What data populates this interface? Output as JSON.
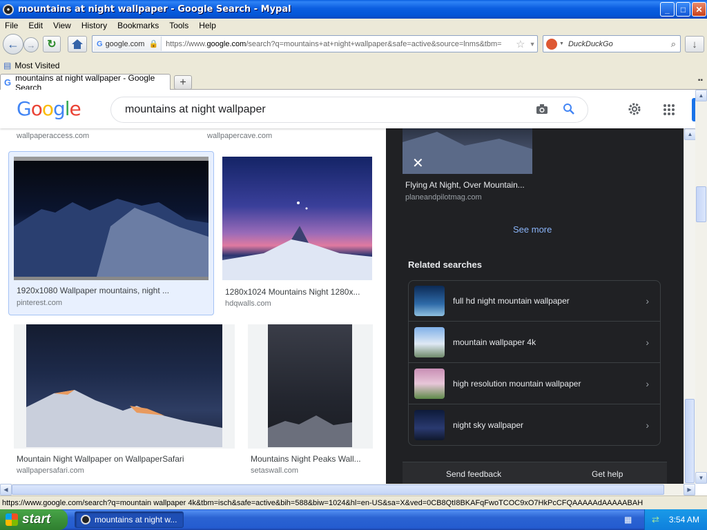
{
  "window": {
    "title": "mountains at night wallpaper - Google Search - Mypal",
    "minimize": "_",
    "maximize": "□",
    "close": "✕"
  },
  "menu": [
    "File",
    "Edit",
    "View",
    "History",
    "Bookmarks",
    "Tools",
    "Help"
  ],
  "nav": {
    "identity": "google.com",
    "url_prefix": "https://www.",
    "url_domain": "google.com",
    "url_rest": "/search?q=mountains+at+night+wallpaper&safe=active&source=lnms&tbm=",
    "search_placeholder": "DuckDuckGo"
  },
  "bookmarks": {
    "most_visited": "Most Visited"
  },
  "tab": {
    "label": "mountains at night wallpaper - Google Search"
  },
  "google": {
    "logo_letters": [
      "G",
      "o",
      "o",
      "g",
      "l",
      "e"
    ],
    "query": "mountains at night wallpaper"
  },
  "results": {
    "top_sources": [
      "wallpaperaccess.com",
      "wallpapercave.com"
    ],
    "items": [
      {
        "caption": "1920x1080 Wallpaper mountains, night ...",
        "source": "pinterest.com"
      },
      {
        "caption": "1280x1024 Mountains Night 1280x...",
        "source": "hdqwalls.com"
      },
      {
        "caption": "Mountain Night Wallpaper on WallpaperSafari",
        "source": "wallpapersafari.com"
      },
      {
        "caption": "Mountains Night Peaks Wall...",
        "source": "setaswall.com"
      }
    ]
  },
  "preview": {
    "caption": "Flying At Night, Over Mountain...",
    "source": "planeandpilotmag.com",
    "see_more": "See more",
    "related_title": "Related searches",
    "related": [
      {
        "label": "full hd night mountain wallpaper"
      },
      {
        "label": "mountain wallpaper 4k"
      },
      {
        "label": "high resolution mountain wallpaper"
      },
      {
        "label": "night sky wallpaper"
      }
    ],
    "send_feedback": "Send feedback",
    "get_help": "Get help"
  },
  "statusbar": {
    "text": "https://www.google.com/search?q=mountain wallpaper 4k&tbm=isch&safe=active&bih=588&biw=1024&hl=en-US&sa=X&ved=0CB8QtI8BKAFqFwoTCOC9xO7HkPcCFQAAAAAdAAAAABAH"
  },
  "taskbar": {
    "start": "start",
    "task": "mountains at night w...",
    "time": "3:54 AM"
  },
  "colors": {
    "google_blue": "#4285f4",
    "google_red": "#ea4335",
    "google_yellow": "#fbbc05",
    "google_green": "#34a853",
    "link_blue": "#8ab4f8",
    "dark_panel": "#202124"
  }
}
